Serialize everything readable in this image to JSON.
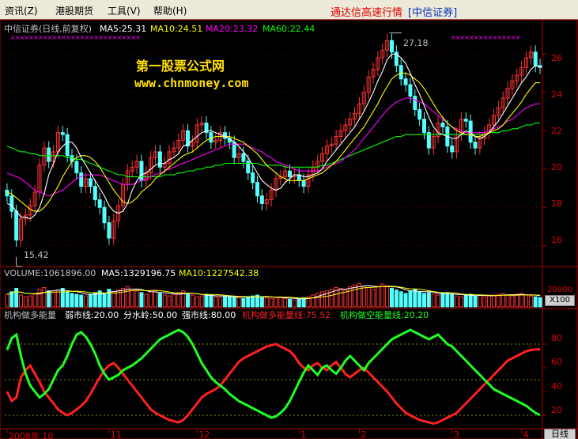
{
  "menu": [
    {
      "id": "news",
      "label": "资讯(Z)"
    },
    {
      "id": "hk",
      "label": "港股期货"
    },
    {
      "id": "tools",
      "label": "工具(V)"
    },
    {
      "id": "help",
      "label": "帮助(H)"
    }
  ],
  "app": {
    "title": "通达信高速行情",
    "broker": "[中信证券]"
  },
  "price_header": {
    "name": "中信证券(日线,前复权)",
    "ma5": "MA5:25.31",
    "ma10": "MA10:24.51",
    "ma20": "MA20:23.32",
    "ma60": "MA60:22.44"
  },
  "watermark": {
    "line1": "第一股票公式网",
    "line2": "www.chnmoney.com"
  },
  "price_annotations": {
    "high": "27.18",
    "low": "15.42"
  },
  "volume_header": {
    "vol": "VOLUME:1061896.00",
    "ma5": "MA5:1329196.75",
    "ma10": "MA10:1227542.38"
  },
  "indicator_header": {
    "name": "机构做多能量",
    "weak": "弱市线:20.00",
    "water": "分水岭:50.00",
    "strong": "强市线:80.00",
    "long": "机构做多能量线:75.52",
    "short": "机构做空能量线:20.20"
  },
  "volume_unit": "X100",
  "volume_tick": "20000",
  "x_ticks": [
    {
      "label": "2008年 10",
      "i": 0
    },
    {
      "label": "11",
      "i": 22
    },
    {
      "label": "12",
      "i": 41
    },
    {
      "label": "1",
      "i": 63
    },
    {
      "label": "2",
      "i": 76
    },
    {
      "label": "3",
      "i": 96
    },
    {
      "label": "4",
      "i": 111
    }
  ],
  "period_button": "日线",
  "colors": {
    "up": "#ff3232",
    "down": "#54ffff",
    "ma5": "#ffffff",
    "ma10": "#ffff00",
    "ma20": "#ff00ff",
    "ma60": "#00ff00",
    "long": "#ff2020",
    "short": "#20ff20",
    "axis": "#b00000",
    "text": "#c0c0c0"
  },
  "chart_data": [
    {
      "type": "candlestick",
      "title": "中信证券(日线,前复权)",
      "x_range": [
        0,
        115
      ],
      "ylim": [
        15,
        27
      ],
      "y_ticks": [
        16,
        18,
        20,
        22,
        24,
        26
      ],
      "grid": true,
      "close": [
        18.6,
        17.8,
        16.3,
        17.4,
        17.6,
        18.1,
        18.8,
        20.2,
        21.1,
        20.4,
        20.9,
        21.9,
        21.8,
        20.7,
        20.4,
        19.8,
        19.1,
        19.5,
        19.1,
        18.4,
        18.0,
        17.2,
        16.4,
        17.3,
        18.1,
        19.2,
        19.9,
        20.1,
        20.4,
        19.4,
        19.8,
        20.6,
        20.9,
        20.1,
        20.3,
        20.9,
        21.1,
        21.5,
        22.0,
        21.2,
        21.4,
        22.3,
        22.4,
        21.9,
        21.4,
        21.5,
        21.9,
        21.6,
        21.4,
        20.6,
        20.8,
        20.4,
        19.8,
        19.3,
        18.6,
        18.2,
        18.4,
        18.9,
        19.5,
        19.6,
        19.9,
        19.6,
        19.7,
        19.4,
        19.1,
        19.7,
        20.1,
        20.4,
        20.8,
        21.2,
        21.3,
        21.7,
        22.0,
        22.3,
        22.6,
        22.9,
        23.4,
        24.0,
        24.8,
        25.2,
        25.8,
        26.2,
        26.7,
        26.1,
        25.4,
        24.7,
        24.4,
        23.8,
        23.1,
        22.6,
        21.9,
        21.1,
        21.7,
        22.4,
        22.2,
        21.2,
        20.9,
        21.8,
        22.6,
        22.5,
        21.4,
        21.1,
        21.6,
        21.9,
        22.3,
        22.8,
        23.2,
        23.7,
        24.2,
        24.6,
        24.9,
        25.3,
        25.8,
        26.1,
        25.4,
        25.3
      ],
      "ma5": [
        18.2,
        18.1,
        17.8,
        17.5,
        17.5,
        17.4,
        17.6,
        18.0,
        18.7,
        19.7,
        20.3,
        20.9,
        21.2,
        21.4,
        21.4,
        21.1,
        20.6,
        20.2,
        19.8,
        19.4,
        19.0,
        18.6,
        18.1,
        17.8,
        17.7,
        17.8,
        18.2,
        18.9,
        19.4,
        19.7,
        19.8,
        20.0,
        20.2,
        20.3,
        20.3,
        20.5,
        20.6,
        20.8,
        21.2,
        21.3,
        21.5,
        21.7,
        21.9,
        22.0,
        22.0,
        21.9,
        21.8,
        21.7,
        21.6,
        21.4,
        21.2,
        20.9,
        20.6,
        20.2,
        19.8,
        19.4,
        19.2,
        19.0,
        18.9,
        19.0,
        19.3,
        19.5,
        19.7,
        19.7,
        19.6,
        19.6,
        19.7,
        19.8,
        20.0,
        20.4,
        20.7,
        21.0,
        21.3,
        21.6,
        21.9,
        22.2,
        22.6,
        23.0,
        23.5,
        24.0,
        24.6,
        25.1,
        25.7,
        26.0,
        26.0,
        25.8,
        25.5,
        25.0,
        24.4,
        23.9,
        23.3,
        22.7,
        22.2,
        21.9,
        21.8,
        21.7,
        21.6,
        21.6,
        21.8,
        22.0,
        21.9,
        21.7,
        21.6,
        21.7,
        21.9,
        22.2,
        22.5,
        22.9,
        23.3,
        23.7,
        24.1,
        24.5,
        24.8,
        25.2,
        25.4,
        25.3
      ],
      "ma10": [
        18.8,
        18.7,
        18.5,
        18.3,
        18.1,
        17.9,
        17.8,
        17.8,
        18.0,
        18.3,
        18.7,
        19.1,
        19.6,
        20.0,
        20.4,
        20.6,
        20.7,
        20.7,
        20.6,
        20.4,
        20.1,
        19.7,
        19.3,
        18.9,
        18.6,
        18.3,
        18.2,
        18.3,
        18.5,
        18.8,
        19.0,
        19.2,
        19.5,
        19.7,
        19.9,
        20.1,
        20.3,
        20.5,
        20.7,
        20.8,
        20.9,
        21.1,
        21.3,
        21.5,
        21.6,
        21.7,
        21.7,
        21.7,
        21.7,
        21.6,
        21.5,
        21.4,
        21.2,
        21.0,
        20.8,
        20.5,
        20.2,
        20.0,
        19.8,
        19.6,
        19.5,
        19.4,
        19.4,
        19.4,
        19.4,
        19.5,
        19.6,
        19.7,
        19.8,
        20.0,
        20.2,
        20.4,
        20.7,
        21.0,
        21.3,
        21.6,
        21.9,
        22.2,
        22.6,
        23.0,
        23.4,
        23.9,
        24.3,
        24.7,
        24.9,
        25.0,
        25.0,
        24.9,
        24.7,
        24.5,
        24.2,
        23.8,
        23.4,
        23.0,
        22.7,
        22.4,
        22.2,
        22.0,
        21.9,
        21.8,
        21.8,
        21.7,
        21.7,
        21.8,
        21.9,
        22.0,
        22.1,
        22.3,
        22.6,
        22.9,
        23.2,
        23.5,
        23.9,
        24.2,
        24.5,
        24.5
      ],
      "ma20": [
        19.8,
        19.7,
        19.6,
        19.5,
        19.3,
        19.1,
        18.9,
        18.8,
        18.7,
        18.6,
        18.7,
        18.8,
        18.9,
        19.1,
        19.3,
        19.5,
        19.6,
        19.7,
        19.7,
        19.7,
        19.7,
        19.6,
        19.5,
        19.4,
        19.3,
        19.2,
        19.2,
        19.2,
        19.3,
        19.4,
        19.5,
        19.6,
        19.7,
        19.8,
        19.9,
        20.0,
        20.1,
        20.2,
        20.3,
        20.4,
        20.5,
        20.6,
        20.7,
        20.8,
        20.9,
        21.0,
        21.1,
        21.2,
        21.3,
        21.3,
        21.3,
        21.3,
        21.2,
        21.1,
        21.0,
        20.9,
        20.7,
        20.6,
        20.4,
        20.3,
        20.2,
        20.1,
        20.0,
        19.9,
        19.9,
        19.9,
        19.9,
        19.9,
        20.0,
        20.1,
        20.2,
        20.3,
        20.4,
        20.6,
        20.8,
        21.0,
        21.3,
        21.6,
        21.9,
        22.2,
        22.5,
        22.8,
        23.1,
        23.3,
        23.5,
        23.6,
        23.7,
        23.7,
        23.6,
        23.5,
        23.4,
        23.2,
        23.0,
        22.8,
        22.6,
        22.4,
        22.2,
        22.1,
        22.0,
        21.9,
        21.9,
        21.9,
        21.9,
        21.9,
        22.0,
        22.1,
        22.2,
        22.3,
        22.5,
        22.6,
        22.8,
        23.0,
        23.2,
        23.3,
        23.4,
        23.4
      ],
      "ma60": [
        21.2,
        21.1,
        21.0,
        20.9,
        20.9,
        20.8,
        20.8,
        20.7,
        20.7,
        20.7,
        20.7,
        20.7,
        20.7,
        20.6,
        20.6,
        20.5,
        20.5,
        20.4,
        20.3,
        20.2,
        20.1,
        20.0,
        19.9,
        19.8,
        19.7,
        19.7,
        19.6,
        19.6,
        19.6,
        19.6,
        19.6,
        19.6,
        19.6,
        19.6,
        19.7,
        19.7,
        19.7,
        19.8,
        19.8,
        19.9,
        19.9,
        20.0,
        20.0,
        20.1,
        20.1,
        20.2,
        20.2,
        20.3,
        20.3,
        20.3,
        20.3,
        20.3,
        20.3,
        20.3,
        20.3,
        20.2,
        20.2,
        20.2,
        20.2,
        20.2,
        20.1,
        20.1,
        20.1,
        20.1,
        20.1,
        20.1,
        20.1,
        20.1,
        20.2,
        20.2,
        20.3,
        20.4,
        20.5,
        20.6,
        20.7,
        20.8,
        20.9,
        21.0,
        21.1,
        21.2,
        21.3,
        21.4,
        21.5,
        21.6,
        21.7,
        21.7,
        21.8,
        21.8,
        21.8,
        21.8,
        21.8,
        21.8,
        21.8,
        21.8,
        21.8,
        21.8,
        21.8,
        21.8,
        21.8,
        21.8,
        21.8,
        21.8,
        21.8,
        21.8,
        21.9,
        21.9,
        21.9,
        22.0,
        22.0,
        22.1,
        22.1,
        22.2,
        22.3,
        22.3,
        22.4,
        22.4
      ],
      "low_point": {
        "i": 2,
        "value": 15.42
      },
      "high_point": {
        "i": 82,
        "value": 27.18
      }
    },
    {
      "type": "bar",
      "title": "VOLUME",
      "ylim": [
        0,
        30000
      ],
      "unit": "X100",
      "values": [
        15000,
        18000,
        22000,
        14000,
        12000,
        13000,
        16000,
        21000,
        23000,
        19000,
        17000,
        20000,
        22000,
        18000,
        16000,
        15000,
        14000,
        13000,
        15000,
        17000,
        19000,
        16000,
        21000,
        18000,
        20000,
        22000,
        24000,
        21000,
        19000,
        17000,
        15000,
        18000,
        20000,
        16000,
        14000,
        13000,
        15000,
        17000,
        19000,
        16000,
        14000,
        12000,
        13000,
        15000,
        14000,
        12000,
        11000,
        12000,
        13000,
        12000,
        11000,
        10000,
        12000,
        13000,
        14000,
        12000,
        11000,
        10000,
        11000,
        12000,
        10000,
        9000,
        8000,
        9000,
        11000,
        12000,
        14000,
        16000,
        18000,
        19000,
        21000,
        23000,
        22000,
        20000,
        24000,
        26000,
        28000,
        25000,
        23000,
        21000,
        24000,
        27000,
        25000,
        22000,
        20000,
        18000,
        16000,
        19000,
        21000,
        18000,
        16000,
        17000,
        15000,
        14000,
        16000,
        17000,
        15000,
        13000,
        12000,
        14000,
        15000,
        13000,
        14000,
        12000,
        13000,
        14000,
        15000,
        16000,
        14000,
        13000,
        15000,
        16000,
        14000,
        13000,
        12000,
        11000
      ]
    },
    {
      "type": "line",
      "title": "机构做多能量",
      "ylim": [
        10,
        100
      ],
      "y_ticks": [
        20,
        40,
        60,
        80
      ],
      "reference_lines": [
        20,
        50,
        80
      ],
      "series": [
        {
          "name": "机构做多能量线",
          "values": [
            40,
            32,
            35,
            52,
            58,
            62,
            55,
            48,
            40,
            35,
            30,
            25,
            22,
            20,
            22,
            25,
            28,
            32,
            38,
            45,
            52,
            58,
            62,
            64,
            60,
            55,
            50,
            45,
            40,
            35,
            30,
            25,
            22,
            20,
            18,
            16,
            15,
            14,
            16,
            20,
            25,
            30,
            35,
            38,
            40,
            42,
            45,
            50,
            55,
            60,
            65,
            68,
            70,
            72,
            74,
            76,
            78,
            79,
            80,
            78,
            76,
            74,
            70,
            64,
            60,
            58,
            62,
            64,
            60,
            58,
            62,
            65,
            60,
            55,
            52,
            55,
            58,
            60,
            56,
            52,
            48,
            44,
            40,
            35,
            30,
            26,
            22,
            20,
            18,
            16,
            15,
            14,
            13,
            14,
            16,
            18,
            20,
            22,
            26,
            30,
            34,
            38,
            42,
            46,
            50,
            54,
            58,
            62,
            66,
            68,
            70,
            72,
            74,
            75,
            75.52,
            75.52
          ]
        },
        {
          "name": "机构做空能量线",
          "values": [
            75,
            85,
            88,
            70,
            55,
            45,
            40,
            35,
            38,
            42,
            50,
            58,
            62,
            70,
            80,
            88,
            90,
            86,
            80,
            72,
            62,
            55,
            50,
            52,
            54,
            58,
            60,
            62,
            65,
            68,
            72,
            76,
            80,
            84,
            86,
            88,
            90,
            92,
            90,
            86,
            80,
            72,
            64,
            58,
            52,
            48,
            45,
            42,
            38,
            35,
            32,
            30,
            28,
            26,
            24,
            22,
            20,
            18,
            19,
            22,
            26,
            32,
            40,
            48,
            56,
            62,
            58,
            54,
            60,
            62,
            58,
            55,
            60,
            66,
            70,
            66,
            62,
            58,
            64,
            68,
            72,
            76,
            80,
            84,
            86,
            88,
            90,
            92,
            90,
            88,
            86,
            84,
            86,
            88,
            84,
            80,
            78,
            74,
            70,
            66,
            62,
            58,
            54,
            50,
            46,
            42,
            40,
            38,
            36,
            34,
            32,
            30,
            28,
            25,
            22,
            20.2
          ]
        }
      ]
    }
  ]
}
